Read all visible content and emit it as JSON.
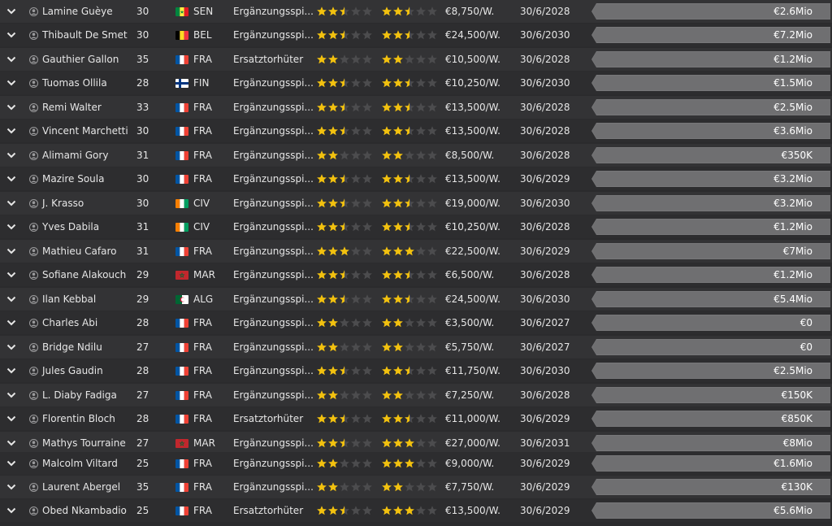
{
  "colors": {
    "row_odd": "#333335",
    "row_even": "#2d2d2f",
    "star_filled": "#f2c10f",
    "star_empty": "#4c4c4e",
    "value_bar": "#6f6f71"
  },
  "icons": {
    "expand": "chevron-down-icon",
    "player": "person-icon",
    "rating": "star-icon"
  },
  "players": [
    {
      "name": "Lamine Guèye",
      "age": "30",
      "nat": "SEN",
      "role": "Ergänzungsspi....",
      "ca": 2.5,
      "pa": 2.5,
      "wage": "€8,750/W.",
      "contract": "30/6/2028",
      "value": "€2.6Mio"
    },
    {
      "name": "Thibault De Smet",
      "age": "30",
      "nat": "BEL",
      "role": "Ergänzungsspi....",
      "ca": 2.5,
      "pa": 2.5,
      "wage": "€24,500/W.",
      "contract": "30/6/2030",
      "value": "€7.2Mio"
    },
    {
      "name": "Gauthier Gallon",
      "age": "35",
      "nat": "FRA",
      "role": "Ersatztorhüter",
      "ca": 2,
      "pa": 2,
      "wage": "€10,500/W.",
      "contract": "30/6/2028",
      "value": "€1.2Mio"
    },
    {
      "name": "Tuomas Ollila",
      "age": "28",
      "nat": "FIN",
      "role": "Ergänzungsspi....",
      "ca": 2.5,
      "pa": 2.5,
      "wage": "€10,250/W.",
      "contract": "30/6/2030",
      "value": "€1.5Mio"
    },
    {
      "name": "Remi Walter",
      "age": "33",
      "nat": "FRA",
      "role": "Ergänzungsspi....",
      "ca": 2.5,
      "pa": 2.5,
      "wage": "€13,500/W.",
      "contract": "30/6/2028",
      "value": "€2.5Mio"
    },
    {
      "name": "Vincent Marchetti",
      "age": "30",
      "nat": "FRA",
      "role": "Ergänzungsspi....",
      "ca": 2.5,
      "pa": 2.5,
      "wage": "€13,500/W.",
      "contract": "30/6/2028",
      "value": "€3.6Mio"
    },
    {
      "name": "Alimami Gory",
      "age": "31",
      "nat": "FRA",
      "role": "Ergänzungsspi....",
      "ca": 2,
      "pa": 2,
      "wage": "€8,500/W.",
      "contract": "30/6/2028",
      "value": "€350K"
    },
    {
      "name": "Mazire Soula",
      "age": "30",
      "nat": "FRA",
      "role": "Ergänzungsspi....",
      "ca": 2.5,
      "pa": 2.5,
      "wage": "€13,500/W.",
      "contract": "30/6/2029",
      "value": "€3.2Mio"
    },
    {
      "name": "J. Krasso",
      "age": "30",
      "nat": "CIV",
      "role": "Ergänzungsspi....",
      "ca": 2.5,
      "pa": 2.5,
      "wage": "€19,000/W.",
      "contract": "30/6/2030",
      "value": "€3.2Mio"
    },
    {
      "name": "Yves Dabila",
      "age": "31",
      "nat": "CIV",
      "role": "Ergänzungsspi....",
      "ca": 2.5,
      "pa": 2.5,
      "wage": "€10,250/W.",
      "contract": "30/6/2028",
      "value": "€1.2Mio"
    },
    {
      "name": "Mathieu Cafaro",
      "age": "31",
      "nat": "FRA",
      "role": "Ergänzungsspi....",
      "ca": 3,
      "pa": 3,
      "wage": "€22,500/W.",
      "contract": "30/6/2029",
      "value": "€7Mio"
    },
    {
      "name": "Sofiane Alakouch",
      "age": "29",
      "nat": "MAR",
      "role": "Ergänzungsspi....",
      "ca": 2.5,
      "pa": 2.5,
      "wage": "€6,500/W.",
      "contract": "30/6/2028",
      "value": "€1.2Mio"
    },
    {
      "name": "Ilan Kebbal",
      "age": "29",
      "nat": "ALG",
      "role": "Ergänzungsspi....",
      "ca": 2.5,
      "pa": 2.5,
      "wage": "€24,500/W.",
      "contract": "30/6/2030",
      "value": "€5.4Mio"
    },
    {
      "name": "Charles Abi",
      "age": "28",
      "nat": "FRA",
      "role": "Ergänzungsspi....",
      "ca": 2,
      "pa": 2,
      "wage": "€3,500/W.",
      "contract": "30/6/2027",
      "value": "€0"
    },
    {
      "name": "Bridge Ndilu",
      "age": "27",
      "nat": "FRA",
      "role": "Ergänzungsspi....",
      "ca": 2,
      "pa": 2,
      "wage": "€5,750/W.",
      "contract": "30/6/2027",
      "value": "€0"
    },
    {
      "name": "Jules Gaudin",
      "age": "28",
      "nat": "FRA",
      "role": "Ergänzungsspi....",
      "ca": 2.5,
      "pa": 2.5,
      "wage": "€11,750/W.",
      "contract": "30/6/2030",
      "value": "€2.5Mio"
    },
    {
      "name": "L. Diaby Fadiga",
      "age": "27",
      "nat": "FRA",
      "role": "Ergänzungsspi....",
      "ca": 2,
      "pa": 2,
      "wage": "€7,250/W.",
      "contract": "30/6/2028",
      "value": "€150K"
    },
    {
      "name": "Florentin Bloch",
      "age": "28",
      "nat": "FRA",
      "role": "Ersatztorhüter",
      "ca": 2.5,
      "pa": 2.5,
      "wage": "€11,000/W.",
      "contract": "30/6/2029",
      "value": "€850K"
    },
    {
      "name": "Mathys Tourraine",
      "age": "27",
      "nat": "MAR",
      "role": "Ergänzungsspi....",
      "ca": 2.5,
      "pa": 3,
      "wage": "€27,000/W.",
      "contract": "30/6/2031",
      "value": "€8Mio"
    },
    {
      "name": "Malcolm Viltard",
      "age": "25",
      "nat": "FRA",
      "role": "Ergänzungsspi....",
      "ca": 2,
      "pa": 3,
      "wage": "€9,000/W.",
      "contract": "30/6/2029",
      "value": "€1.6Mio"
    },
    {
      "name": "Laurent Abergel",
      "age": "35",
      "nat": "FRA",
      "role": "Ergänzungsspi....",
      "ca": 2,
      "pa": 2,
      "wage": "€7,750/W.",
      "contract": "30/6/2029",
      "value": "€130K"
    },
    {
      "name": "Obed Nkambadio",
      "age": "25",
      "nat": "FRA",
      "role": "Ersatztorhüter",
      "ca": 2.5,
      "pa": 3,
      "wage": "€13,500/W.",
      "contract": "30/6/2029",
      "value": "€5.6Mio"
    }
  ]
}
